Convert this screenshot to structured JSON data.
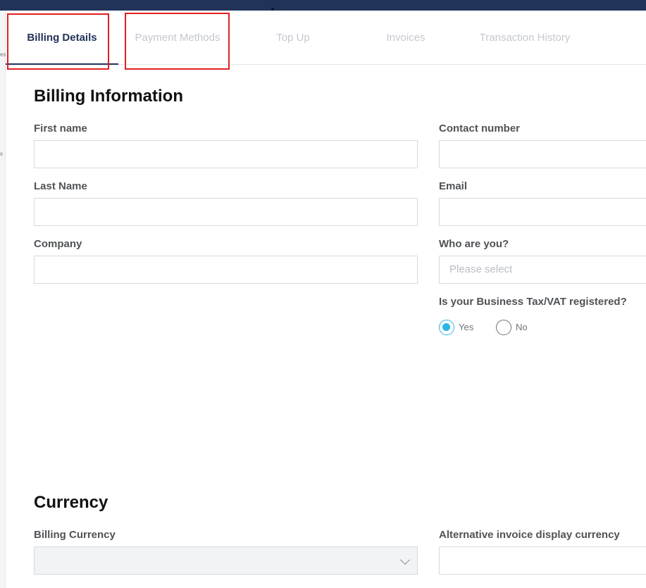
{
  "tabs": [
    {
      "label": "Billing Details",
      "active": true
    },
    {
      "label": "Payment Methods",
      "active": false
    },
    {
      "label": "Top Up",
      "active": false
    },
    {
      "label": "Invoices",
      "active": false
    },
    {
      "label": "Transaction History",
      "active": false
    }
  ],
  "sidebar_fragments": [
    "es",
    "s"
  ],
  "billing": {
    "heading": "Billing Information",
    "first_name_label": "First name",
    "last_name_label": "Last Name",
    "company_label": "Company",
    "contact_label": "Contact number",
    "email_label": "Email",
    "who_label": "Who are you?",
    "who_placeholder": "Please select",
    "vat_label": "Is your Business Tax/VAT registered?",
    "vat_yes": "Yes",
    "vat_no": "No",
    "vat_selected": "Yes"
  },
  "currency": {
    "heading": "Currency",
    "billing_currency_label": "Billing Currency",
    "billing_currency_value": "",
    "alt_currency_label": "Alternative invoice display currency"
  },
  "colors": {
    "topbar": "#22335a",
    "active_tab": "#22335a",
    "radio_selected": "#29b6e6",
    "highlight_box": "#e02020"
  }
}
